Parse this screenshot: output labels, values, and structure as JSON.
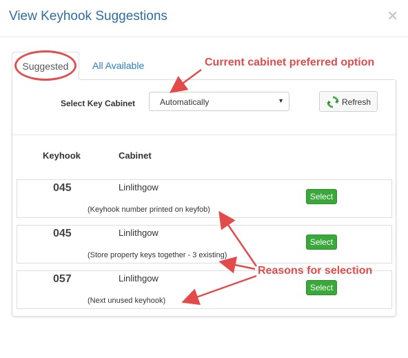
{
  "modal": {
    "title": "View Keyhook Suggestions",
    "close_glyph": "×"
  },
  "tabs": [
    {
      "label": "Suggested",
      "active": true
    },
    {
      "label": "All Available",
      "active": false
    }
  ],
  "filter": {
    "label": "Select Key Cabinet",
    "selected": "Automatically",
    "refresh_label": "Refresh"
  },
  "table": {
    "columns": [
      "Keyhook",
      "Cabinet"
    ],
    "rows": [
      {
        "keyhook": "045",
        "cabinet": "Linlithgow",
        "reason": "(Keyhook number printed on keyfob)",
        "action": "Select"
      },
      {
        "keyhook": "045",
        "cabinet": "Linlithgow",
        "reason": "(Store property keys together - 3 existing)",
        "action": "Select"
      },
      {
        "keyhook": "057",
        "cabinet": "Linlithgow",
        "reason": "(Next unused keyhook)",
        "action": "Select"
      }
    ]
  },
  "annotations": {
    "cabinet_note": "Current cabinet preferred option",
    "reasons_note": "Reasons for selection"
  },
  "icons": {
    "refresh": "refresh-icon",
    "dropdown": "chevron-down-icon",
    "close": "close-icon"
  },
  "colors": {
    "title": "#2e6da4",
    "link": "#2a7ec2",
    "select_button": "#3aa83a",
    "annotation": "#e34a4a"
  }
}
